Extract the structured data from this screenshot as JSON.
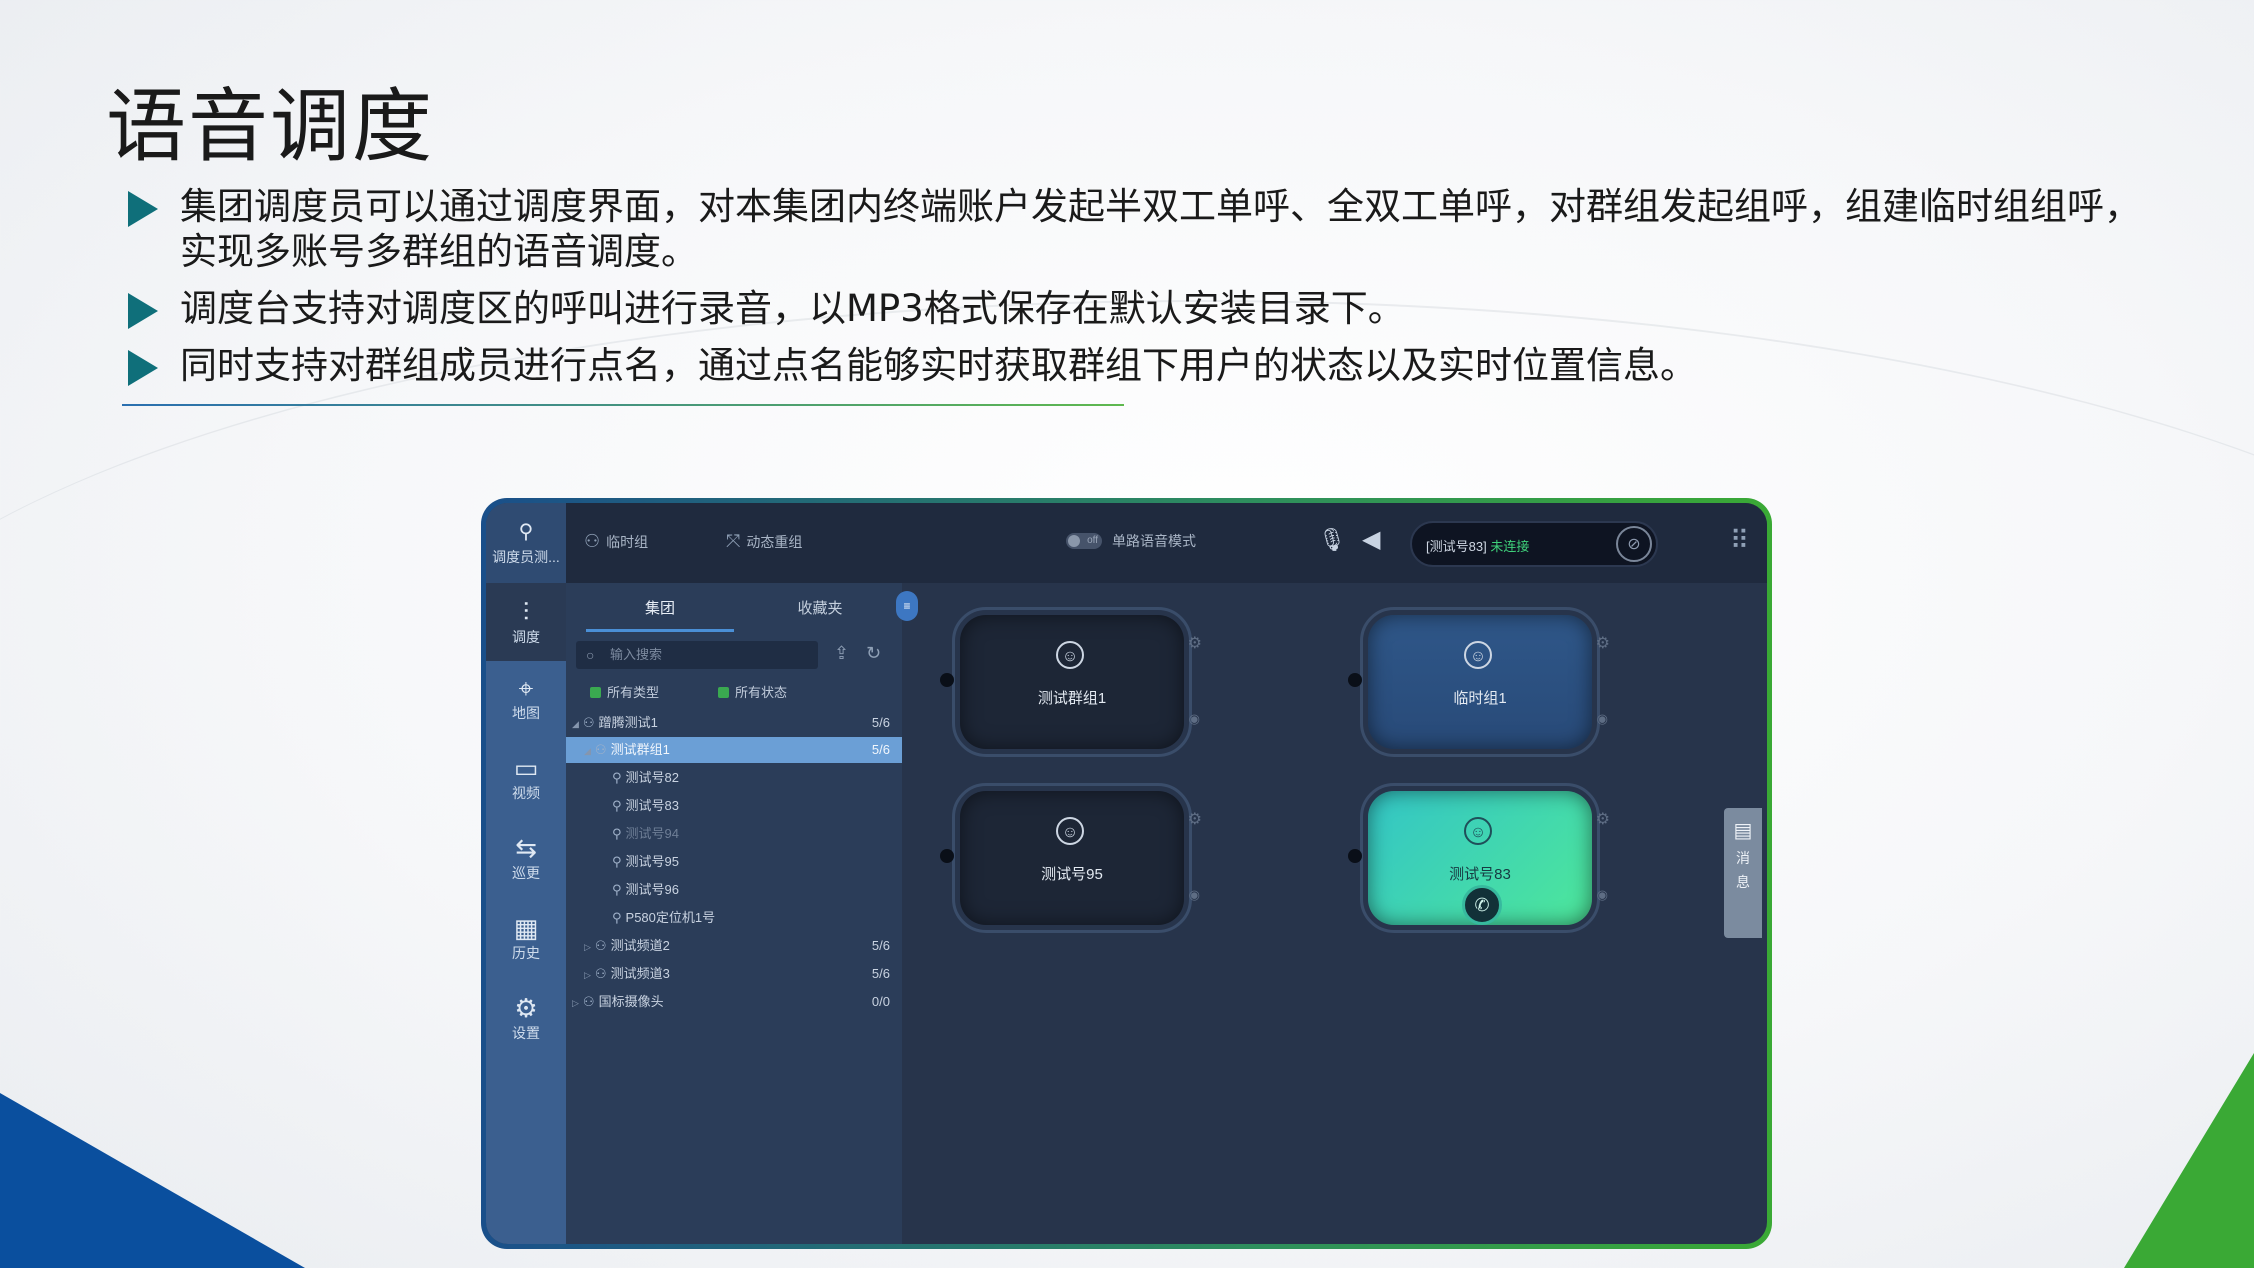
{
  "slide": {
    "title": "语音调度",
    "bullets": [
      "集团调度员可以通过调度界面，对本集团内终端账户发起半双工单呼、全双工单呼，对群组发起组呼，组建临时组组呼，实现多账号多群组的语音调度。",
      "调度台支持对调度区的呼叫进行录音，以MP3格式保存在默认安装目录下。",
      "同时支持对群组成员进行点名，通过点名能够实时获取群组下用户的状态以及实时位置信息。"
    ]
  },
  "app": {
    "sidebar": {
      "user_label": "调度员测...",
      "items": [
        {
          "label": "调度",
          "icon": "waveform-icon"
        },
        {
          "label": "地图",
          "icon": "map-icon"
        },
        {
          "label": "视频",
          "icon": "video-icon"
        },
        {
          "label": "巡更",
          "icon": "patrol-icon"
        },
        {
          "label": "历史",
          "icon": "history-icon"
        },
        {
          "label": "设置",
          "icon": "gear-icon"
        }
      ]
    },
    "topbar": {
      "temp_group": "临时组",
      "dynamic_regroup": "动态重组",
      "toggle_state": "off",
      "single_voice_mode": "单路语音模式",
      "status_name": "[测试号83]",
      "status_state": "未连接"
    },
    "panel": {
      "tabs": [
        "集团",
        "收藏夹"
      ],
      "search_placeholder": "输入搜索",
      "filter_type": "所有类型",
      "filter_state": "所有状态",
      "tree": [
        {
          "label": "蹭腾测试1",
          "count": "5/6"
        },
        {
          "label": "测试群组1",
          "count": "5/6"
        },
        {
          "label": "测试号82",
          "count": ""
        },
        {
          "label": "测试号83",
          "count": ""
        },
        {
          "label": "测试号94",
          "count": ""
        },
        {
          "label": "测试号95",
          "count": ""
        },
        {
          "label": "测试号96",
          "count": ""
        },
        {
          "label": "P580定位机1号",
          "count": ""
        },
        {
          "label": "测试频道2",
          "count": "5/6"
        },
        {
          "label": "测试频道3",
          "count": "5/6"
        },
        {
          "label": "国标摄像头",
          "count": "0/0"
        }
      ]
    },
    "cards": [
      {
        "name": "测试群组1"
      },
      {
        "name": "临时组1"
      },
      {
        "name": "测试号95"
      },
      {
        "name": "测试号83"
      }
    ],
    "message_tab": {
      "line1": "消",
      "line2": "息"
    }
  }
}
